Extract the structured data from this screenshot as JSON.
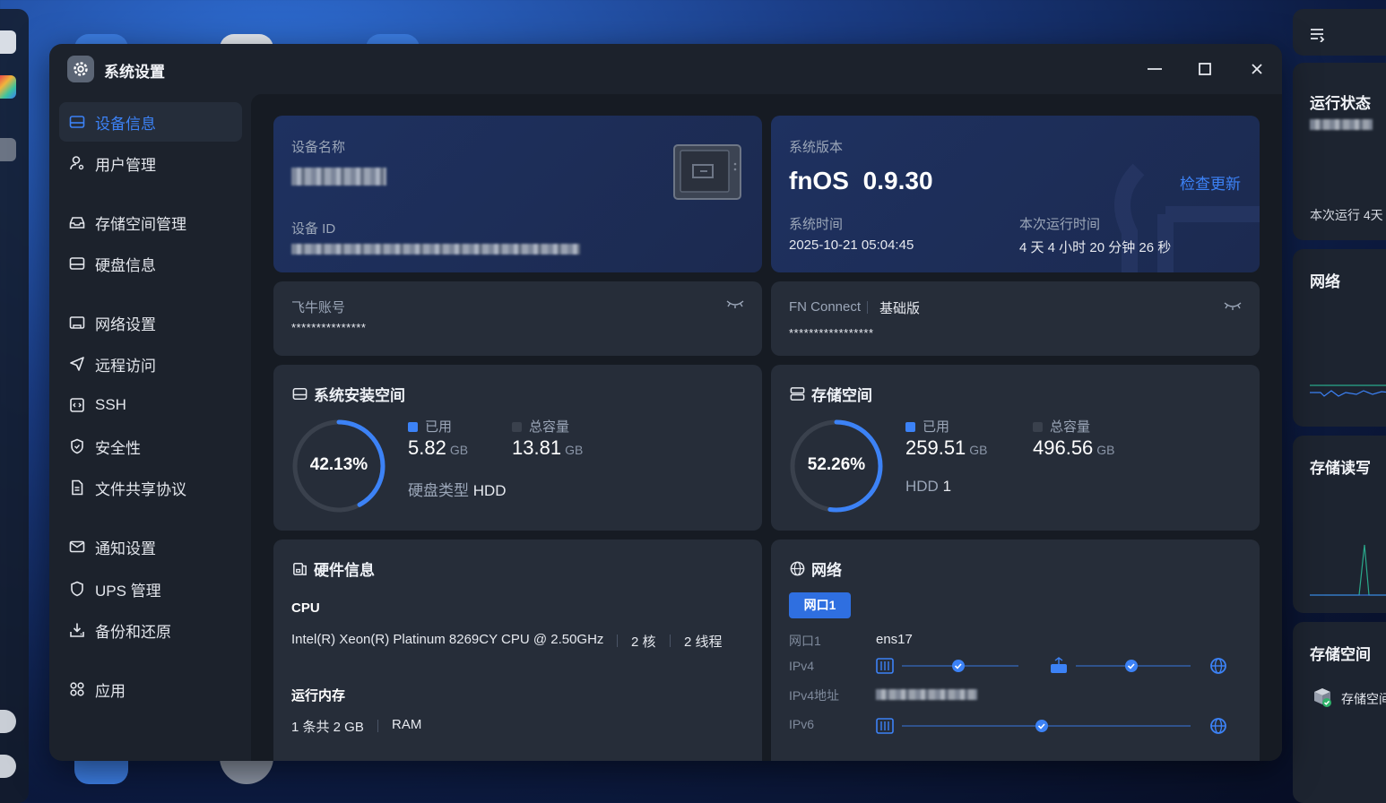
{
  "window": {
    "title": "系统设置",
    "app_icon": "gear-icon"
  },
  "sidebar": {
    "items": [
      {
        "label": "设备信息",
        "icon": "drive-icon",
        "active": true
      },
      {
        "label": "用户管理",
        "icon": "user-icon"
      },
      {
        "label": "存储空间管理",
        "icon": "storage-icon"
      },
      {
        "label": "硬盘信息",
        "icon": "disk-icon"
      },
      {
        "label": "网络设置",
        "icon": "network-icon"
      },
      {
        "label": "远程访问",
        "icon": "send-icon"
      },
      {
        "label": "SSH",
        "icon": "ssh-icon"
      },
      {
        "label": "安全性",
        "icon": "shield-icon"
      },
      {
        "label": "文件共享协议",
        "icon": "file-icon"
      },
      {
        "label": "通知设置",
        "icon": "mail-icon"
      },
      {
        "label": "UPS 管理",
        "icon": "ups-icon"
      },
      {
        "label": "备份和还原",
        "icon": "backup-icon"
      },
      {
        "label": "应用",
        "icon": "apps-icon"
      }
    ]
  },
  "device": {
    "name_label": "设备名称",
    "id_label": "设备 ID"
  },
  "version": {
    "label": "系统版本",
    "os": "fnOS",
    "number": "0.9.30",
    "update_link": "检查更新",
    "time_label": "系统时间",
    "time_value": "2025-10-21 05:04:45",
    "uptime_label": "本次运行时间",
    "uptime_value": "4 天 4 小时 20 分钟 26 秒"
  },
  "account": {
    "label": "飞牛账号",
    "masked": "***************"
  },
  "connect": {
    "label": "FN Connect",
    "tier": "基础版",
    "masked": "*****************"
  },
  "sys_space": {
    "title": "系统安装空间",
    "percent_label": "42.13%",
    "percent": 42.13,
    "used_label": "已用",
    "used_value": "5.82",
    "used_unit": "GB",
    "total_label": "总容量",
    "total_value": "13.81",
    "total_unit": "GB",
    "disk_type_label": "硬盘类型",
    "disk_type_value": "HDD"
  },
  "storage": {
    "title": "存储空间",
    "percent_label": "52.26%",
    "percent": 52.26,
    "used_label": "已用",
    "used_value": "259.51",
    "used_unit": "GB",
    "total_label": "总容量",
    "total_value": "496.56",
    "total_unit": "GB",
    "disk_label": "HDD",
    "disk_count": "1"
  },
  "hardware": {
    "title": "硬件信息",
    "cpu_label": "CPU",
    "cpu_model": "Intel(R) Xeon(R) Platinum 8269CY CPU @ 2.50GHz",
    "cores": "2 核",
    "threads": "2 线程",
    "mem_label": "运行内存",
    "mem_value": "1 条共 2 GB",
    "mem_type": "RAM"
  },
  "network": {
    "title": "网络",
    "tab": "网口1",
    "port_label": "网口1",
    "port_value": "ens17",
    "ipv4_label": "IPv4",
    "ipv4_addr_label": "IPv4地址",
    "ipv6_label": "IPv6"
  },
  "right_panel": {
    "status_title": "运行状态",
    "uptime_text": "本次运行 4天",
    "network_title": "网络",
    "io_title": "存储读写",
    "space_title": "存储空间",
    "space_item": "存储空间"
  },
  "colors": {
    "accent": "#3c82f6",
    "ring_bg": "#3a414d",
    "card": "#262d39"
  }
}
